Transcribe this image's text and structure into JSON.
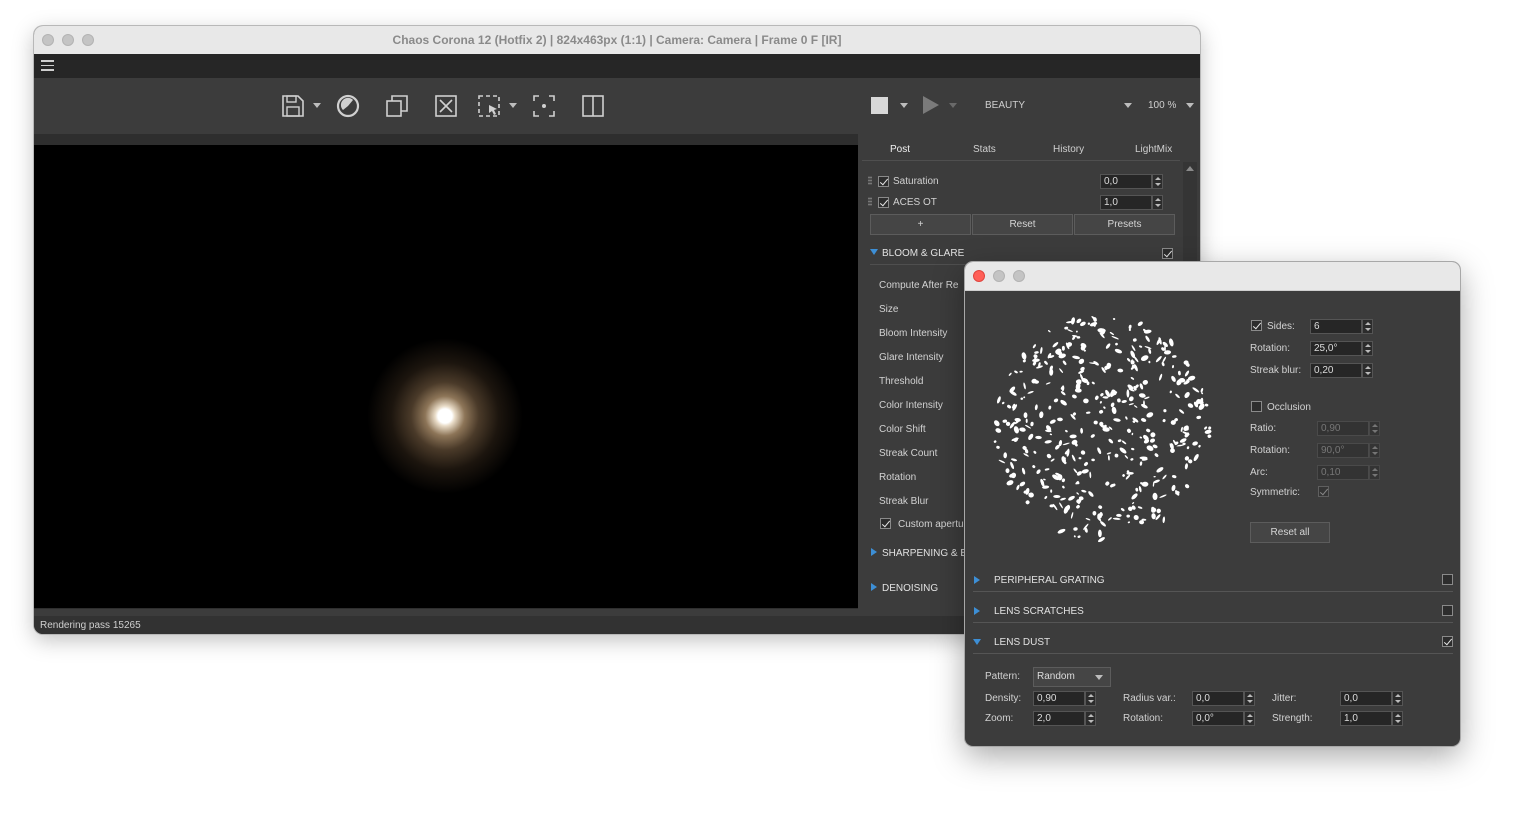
{
  "main_window": {
    "title": "Chaos Corona 12 (Hotfix 2) | 824x463px (1:1) | Camera: Camera | Frame 0 F [IR]",
    "toolbar": {
      "icons": [
        "save-icon",
        "render-icon",
        "copy-icon",
        "clear-icon",
        "region-select-icon",
        "focus-icon",
        "split-view-icon",
        "stop-icon",
        "play-icon"
      ],
      "pass_select": "BEAUTY",
      "zoom_select": "100 %"
    },
    "status": "Rendering pass 15265",
    "tabs": [
      "Post",
      "Stats",
      "History",
      "LightMix"
    ],
    "post": {
      "rows": [
        {
          "label": "Saturation",
          "value": "0,0",
          "checked": true
        },
        {
          "label": "ACES OT",
          "value": "1,0",
          "checked": true
        }
      ],
      "buttons": {
        "add": "+",
        "reset": "Reset",
        "presets": "Presets"
      },
      "bloom_glare": {
        "title": "BLOOM & GLARE",
        "enabled": true,
        "items": [
          "Compute After Re",
          "Size",
          "Bloom Intensity",
          "Glare Intensity",
          "Threshold",
          "Color Intensity",
          "Color Shift",
          "Streak Count",
          "Rotation",
          "Streak Blur"
        ],
        "custom_aperture": "Custom apertu"
      },
      "sharpening_title": "SHARPENING & B",
      "denoising_title": "DENOISING"
    }
  },
  "dialog": {
    "aperture": {
      "sides": {
        "label": "Sides:",
        "value": "6",
        "checked": true
      },
      "rotation": {
        "label": "Rotation:",
        "value": "25,0°"
      },
      "streak_blur": {
        "label": "Streak blur:",
        "value": "0,20"
      }
    },
    "occlusion": {
      "label": "Occlusion",
      "checked": false,
      "ratio": {
        "label": "Ratio:",
        "value": "0,90"
      },
      "rotation": {
        "label": "Rotation:",
        "value": "90,0°"
      },
      "arc": {
        "label": "Arc:",
        "value": "0,10"
      },
      "symmetric": {
        "label": "Symmetric:",
        "checked": true
      }
    },
    "reset_all": "Reset all",
    "sections": [
      {
        "title": "PERIPHERAL GRATING",
        "enabled": false
      },
      {
        "title": "LENS SCRATCHES",
        "enabled": false
      },
      {
        "title": "LENS DUST",
        "enabled": true
      }
    ],
    "lens_dust": {
      "pattern": {
        "label": "Pattern:",
        "value": "Random"
      },
      "density": {
        "label": "Density:",
        "value": "0,90"
      },
      "zoom": {
        "label": "Zoom:",
        "value": "2,0"
      },
      "radius_var": {
        "label": "Radius var.:",
        "value": "0,0"
      },
      "rotation": {
        "label": "Rotation:",
        "value": "0,0°"
      },
      "jitter": {
        "label": "Jitter:",
        "value": "0,0"
      },
      "strength": {
        "label": "Strength:",
        "value": "1,0"
      }
    },
    "colors": {
      "close": "#ff5f57",
      "accent": "#3d8fd6"
    }
  }
}
